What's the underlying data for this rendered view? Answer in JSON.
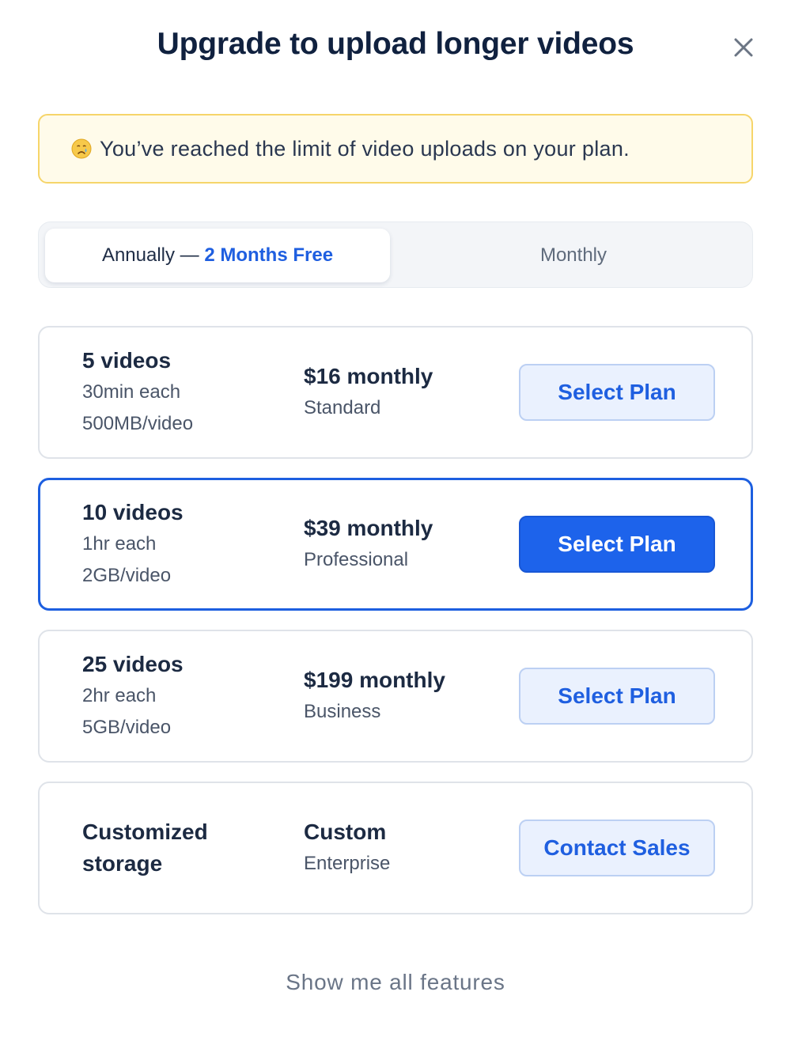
{
  "modal": {
    "title": "Upgrade to upload longer videos",
    "close_icon": "close-icon"
  },
  "alert": {
    "emoji_icon": "crying-face-icon",
    "message": "You’ve reached the limit of video uploads on your plan."
  },
  "billing_toggle": {
    "annual_label": "Annually — ",
    "annual_highlight": "2 Months Free",
    "monthly_label": "Monthly",
    "selected": "annual"
  },
  "plans": [
    {
      "videos": "5 videos",
      "duration": "30min each",
      "size": "500MB/video",
      "price": "$16 monthly",
      "tier": "Standard",
      "button": "Select Plan",
      "selected": false
    },
    {
      "videos": "10 videos",
      "duration": "1hr each",
      "size": "2GB/video",
      "price": "$39 monthly",
      "tier": "Professional",
      "button": "Select Plan",
      "selected": true
    },
    {
      "videos": "25 videos",
      "duration": "2hr each",
      "size": "5GB/video",
      "price": "$199 monthly",
      "tier": "Business",
      "button": "Select Plan",
      "selected": false
    },
    {
      "storage_line1": "Customized",
      "storage_line2": "storage",
      "price": "Custom",
      "tier": "Enterprise",
      "button": "Contact Sales",
      "selected": false
    }
  ],
  "footer": {
    "link": "Show me all features"
  },
  "colors": {
    "accent": "#1d63eb",
    "title": "#10213f",
    "alert_bg": "#fffbea",
    "alert_border": "#f6d56a"
  }
}
